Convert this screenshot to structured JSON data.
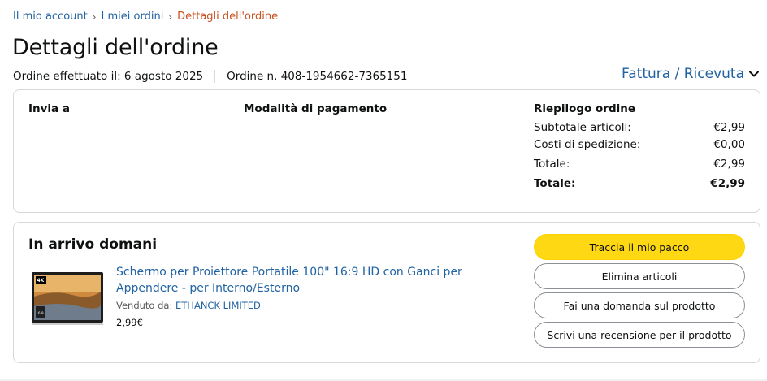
{
  "breadcrumb": {
    "items": [
      "Il mio account",
      "I miei ordini"
    ],
    "current": "Dettagli dell'ordine",
    "separator": "›"
  },
  "page": {
    "title": "Dettagli dell'ordine",
    "order_date": "Ordine effettuato il: 6 agosto 2025",
    "order_number": "Ordine n. 408-1954662-7365151",
    "invoice_label": "Fattura / Ricevuta"
  },
  "summary": {
    "ship_to_label": "Invia a",
    "payment_label": "Modalità di pagamento",
    "order_summary_label": "Riepilogo ordine",
    "rows": [
      {
        "label": "Subtotale articoli:",
        "value": "€2,99"
      },
      {
        "label": "Costi di spedizione:",
        "value": "€0,00"
      },
      {
        "label": "Totale:",
        "value": "€2,99"
      }
    ],
    "grand_total": {
      "label": "Totale:",
      "value": "€2,99"
    }
  },
  "shipment": {
    "status": "In arrivo domani",
    "product": {
      "title": "Schermo per Proiettore Portatile 100\" 16:9 HD con Ganci per Appendere - per Interno/Esterno",
      "sold_by_label": "Venduto da:",
      "seller": "ETHANCK LIMITED",
      "price": "2,99€",
      "image_badges": [
        "4K",
        "16:9"
      ]
    },
    "buttons": {
      "track": "Traccia il mio pacco",
      "remove": "Elimina articoli",
      "question": "Fai una domanda sul prodotto",
      "review": "Scrivi una recensione per il prodotto"
    }
  },
  "colors": {
    "link": "#2162a1",
    "current_crumb": "#c7511f",
    "primary_button": "#ffd814",
    "border": "#d5d9d9"
  }
}
